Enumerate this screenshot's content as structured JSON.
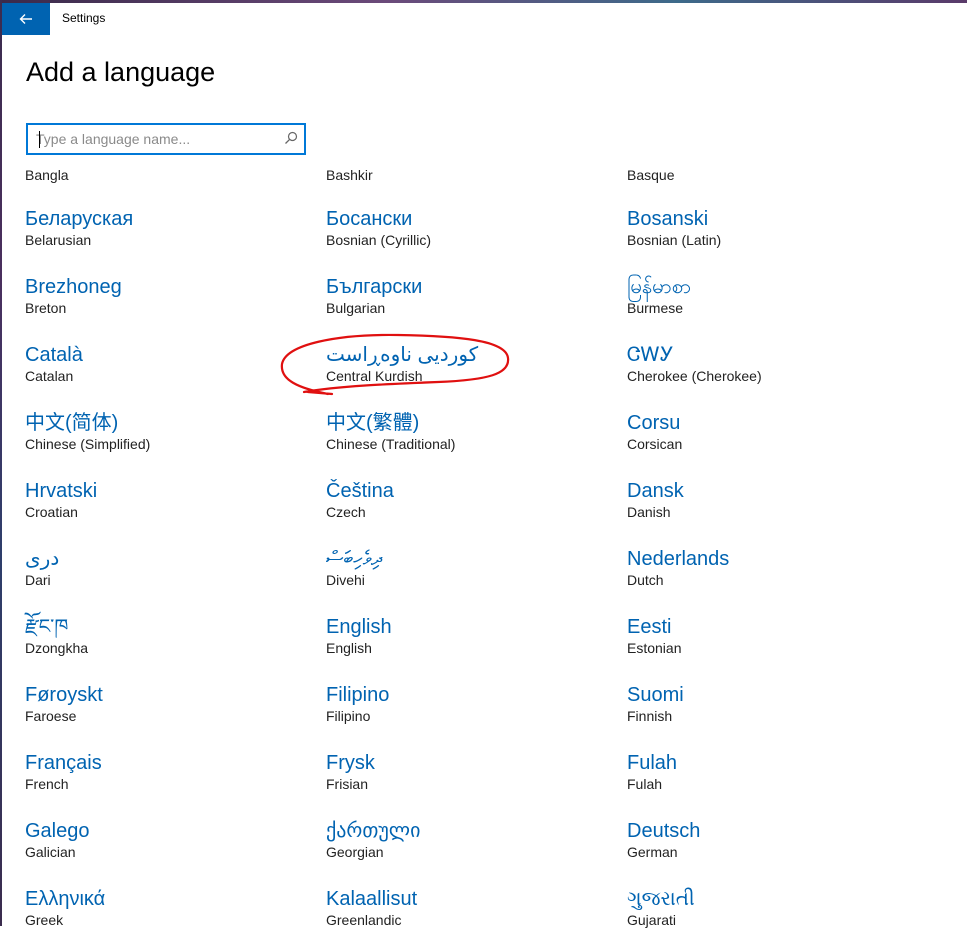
{
  "window": {
    "title": "Settings"
  },
  "page": {
    "title": "Add a language"
  },
  "search": {
    "placeholder": "Type a language name..."
  },
  "colors": {
    "accent": "#0063b1",
    "annotation": "#e01010"
  },
  "top_row": [
    "Bangla",
    "Bashkir",
    "Basque"
  ],
  "languages": [
    {
      "native": "Беларуская",
      "english": "Belarusian"
    },
    {
      "native": "Босански",
      "english": "Bosnian (Cyrillic)"
    },
    {
      "native": "Bosanski",
      "english": "Bosnian (Latin)"
    },
    {
      "native": "Brezhoneg",
      "english": "Breton"
    },
    {
      "native": "Български",
      "english": "Bulgarian"
    },
    {
      "native": "မြန်မာစာ",
      "english": "Burmese"
    },
    {
      "native": "Català",
      "english": "Catalan"
    },
    {
      "native": "کوردیی ناوەڕاست",
      "english": "Central Kurdish"
    },
    {
      "native": "ᏣᎳᎩ",
      "english": "Cherokee (Cherokee)"
    },
    {
      "native": "中文(简体)",
      "english": "Chinese (Simplified)"
    },
    {
      "native": "中文(繁體)",
      "english": "Chinese (Traditional)"
    },
    {
      "native": "Corsu",
      "english": "Corsican"
    },
    {
      "native": "Hrvatski",
      "english": "Croatian"
    },
    {
      "native": "Čeština",
      "english": "Czech"
    },
    {
      "native": "Dansk",
      "english": "Danish"
    },
    {
      "native": "دری",
      "english": "Dari"
    },
    {
      "native": "ދިވެހިބަސް",
      "english": "Divehi"
    },
    {
      "native": "Nederlands",
      "english": "Dutch"
    },
    {
      "native": "རྫོང་ཁ",
      "english": "Dzongkha"
    },
    {
      "native": "English",
      "english": "English"
    },
    {
      "native": "Eesti",
      "english": "Estonian"
    },
    {
      "native": "Føroyskt",
      "english": "Faroese"
    },
    {
      "native": "Filipino",
      "english": "Filipino"
    },
    {
      "native": "Suomi",
      "english": "Finnish"
    },
    {
      "native": "Français",
      "english": "French"
    },
    {
      "native": "Frysk",
      "english": "Frisian"
    },
    {
      "native": "Fulah",
      "english": "Fulah"
    },
    {
      "native": "Galego",
      "english": "Galician"
    },
    {
      "native": "ქართული",
      "english": "Georgian"
    },
    {
      "native": "Deutsch",
      "english": "German"
    },
    {
      "native": "Ελληνικά",
      "english": "Greek"
    },
    {
      "native": "Kalaallisut",
      "english": "Greenlandic"
    },
    {
      "native": "ગુજરાતી",
      "english": "Gujarati"
    }
  ]
}
